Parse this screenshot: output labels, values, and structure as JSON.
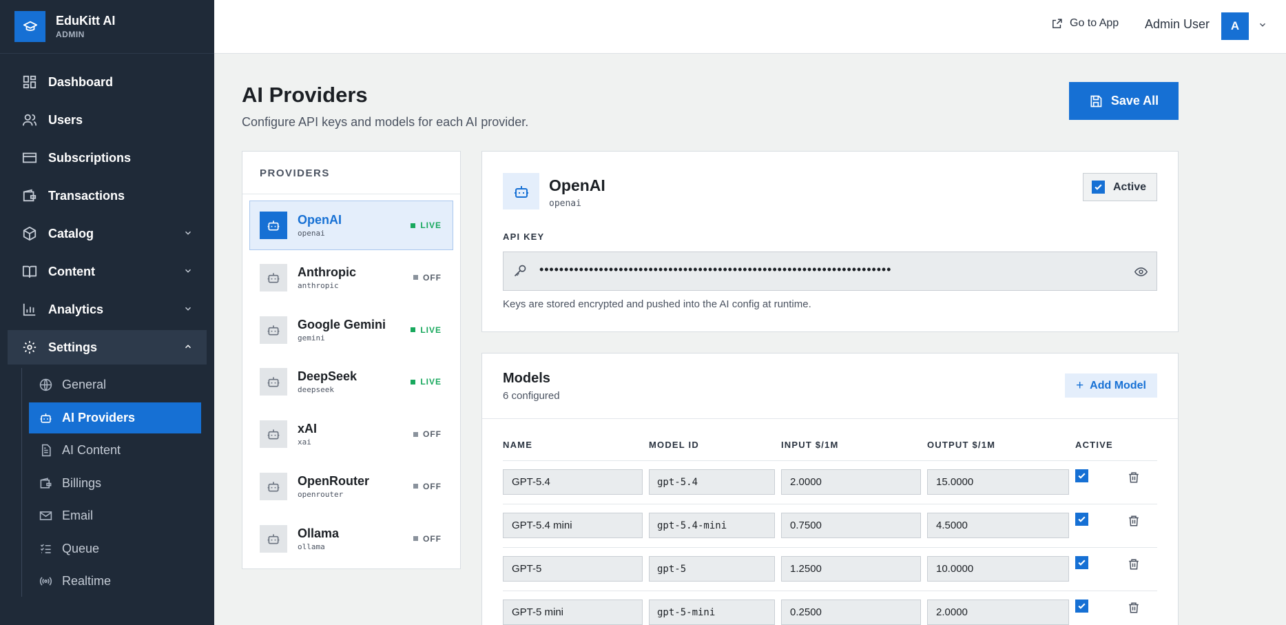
{
  "brand": {
    "name": "EduKitt AI",
    "sub": "ADMIN"
  },
  "nav": {
    "dashboard": "Dashboard",
    "users": "Users",
    "subscriptions": "Subscriptions",
    "transactions": "Transactions",
    "catalog": "Catalog",
    "content": "Content",
    "analytics": "Analytics",
    "settings": "Settings",
    "sub": {
      "general": "General",
      "ai_providers": "AI Providers",
      "ai_content": "AI Content",
      "billings": "Billings",
      "email": "Email",
      "queue": "Queue",
      "realtime": "Realtime"
    }
  },
  "topbar": {
    "go_to_app": "Go to App",
    "user_name": "Admin User",
    "avatar_initial": "A"
  },
  "header": {
    "title": "AI Providers",
    "subtitle": "Configure API keys and models for each AI provider.",
    "save_all": "Save All"
  },
  "providers": {
    "heading": "PROVIDERS",
    "items": [
      {
        "name": "OpenAI",
        "slug": "openai",
        "status": "LIVE"
      },
      {
        "name": "Anthropic",
        "slug": "anthropic",
        "status": "OFF"
      },
      {
        "name": "Google Gemini",
        "slug": "gemini",
        "status": "LIVE"
      },
      {
        "name": "DeepSeek",
        "slug": "deepseek",
        "status": "LIVE"
      },
      {
        "name": "xAI",
        "slug": "xai",
        "status": "OFF"
      },
      {
        "name": "OpenRouter",
        "slug": "openrouter",
        "status": "OFF"
      },
      {
        "name": "Ollama",
        "slug": "ollama",
        "status": "OFF"
      }
    ]
  },
  "detail": {
    "name": "OpenAI",
    "slug": "openai",
    "active_label": "Active",
    "active": true,
    "api_key_label": "API KEY",
    "api_key_masked": "•••••••••••••••••••••••••••••••••••••••••••••••••••••••••••••••••••••••",
    "api_key_help": "Keys are stored encrypted and pushed into the AI config at runtime."
  },
  "models": {
    "title": "Models",
    "count": "6 configured",
    "add_label": "Add Model",
    "headers": {
      "name": "NAME",
      "model_id": "MODEL ID",
      "input": "INPUT $/1M",
      "output": "OUTPUT $/1M",
      "active": "ACTIVE"
    },
    "rows": [
      {
        "name": "GPT-5.4",
        "model_id": "gpt-5.4",
        "input": "2.0000",
        "output": "15.0000",
        "active": true
      },
      {
        "name": "GPT-5.4 mini",
        "model_id": "gpt-5.4-mini",
        "input": "0.7500",
        "output": "4.5000",
        "active": true
      },
      {
        "name": "GPT-5",
        "model_id": "gpt-5",
        "input": "1.2500",
        "output": "10.0000",
        "active": true
      },
      {
        "name": "GPT-5 mini",
        "model_id": "gpt-5-mini",
        "input": "0.2500",
        "output": "2.0000",
        "active": true
      }
    ]
  },
  "colors": {
    "accent": "#1670d4",
    "sidebar_bg": "#1f2a38",
    "live": "#18a85d",
    "page_bg": "#f0f2f1"
  }
}
